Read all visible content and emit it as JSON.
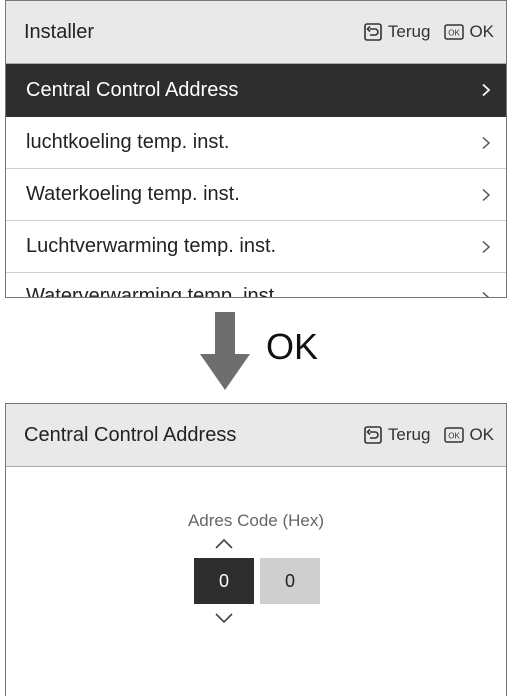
{
  "screen1": {
    "header": {
      "title": "Installer",
      "back_label": "Terug",
      "ok_label": "OK"
    },
    "items": [
      {
        "label": "Central Control Address"
      },
      {
        "label": "luchtkoeling temp. inst."
      },
      {
        "label": "Waterkoeling temp. inst."
      },
      {
        "label": "Luchtverwarming temp. inst."
      },
      {
        "label": "Waterverwarming temp. inst."
      }
    ],
    "selected_index": 0
  },
  "transition": {
    "caption": "OK",
    "icon": "arrow-down-icon"
  },
  "screen2": {
    "header": {
      "title": "Central Control Address",
      "back_label": "Terug",
      "ok_label": "OK"
    },
    "field_label": "Adres Code (Hex)",
    "digits": [
      "0",
      "0"
    ],
    "active_digit_index": 0
  },
  "colors": {
    "selected_bg": "#2e2e2e",
    "header_bg": "#e9e9e9",
    "inactive_digit_bg": "#cfcfcf",
    "arrow": "#6e6e6e"
  },
  "icons": {
    "back": "return-icon",
    "ok": "ok-key-icon",
    "chevron": "chevron-right-icon"
  }
}
